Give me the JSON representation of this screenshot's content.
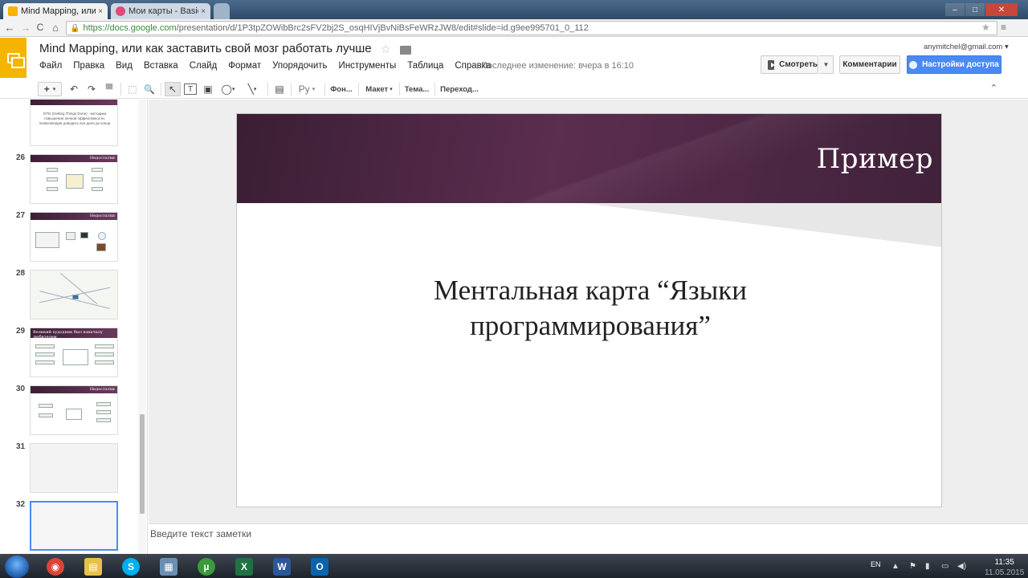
{
  "browser": {
    "tabs": [
      {
        "title": "Mind Mapping, или",
        "close": "×",
        "favicon_color": "#f4b400"
      },
      {
        "title": "Мои карты - Basic",
        "close": "×",
        "favicon_color": "#e04a7a"
      }
    ],
    "url_host": "https://docs.google.com",
    "url_path": "/presentation/d/1P3tpZOWibBrc2sFV2bj2S_osqHIVjBvNiBsFeWRzJW8/edit#slide=id.g9ee995701_0_112",
    "nav": {
      "back": "←",
      "forward": "→",
      "reload": "C",
      "home": "⌂"
    }
  },
  "docs": {
    "title": "Mind Mapping, или как заставить свой мозг работать лучше",
    "menu": [
      "Файл",
      "Правка",
      "Вид",
      "Вставка",
      "Слайд",
      "Формат",
      "Упорядочить",
      "Инструменты",
      "Таблица",
      "Справка"
    ],
    "last_edit": "Последнее изменение: вчера в 16:10",
    "account": "anymitchel@gmail.com",
    "present_label": "Смотреть",
    "comments_label": "Комментарии",
    "share_label": "Настройки доступа",
    "brand_color": "#f4b400",
    "share_color": "#4a8af4"
  },
  "toolbar": {
    "add": "+",
    "undo": "↶",
    "redo": "↷",
    "zoom": "🔍",
    "select": "↖",
    "text": "T",
    "font": "Ру",
    "background_label": "Фон...",
    "layout_label": "Макет",
    "theme_label": "Тема...",
    "transition_label": "Переход...",
    "collapse": "⌃"
  },
  "filmstrip": {
    "first_partial_text": "GTD (Getting Things Done) - методика повышения личной эффективности, позволяющая доводить все дела до конца",
    "slides": [
      {
        "number": "26",
        "band": "Недостатки"
      },
      {
        "number": "27",
        "band": "Недостатки"
      },
      {
        "number": "28",
        "band": ""
      },
      {
        "number": "29",
        "band": "Великий худодник был взначалу любителем"
      },
      {
        "number": "30",
        "band": "Недостатки"
      },
      {
        "number": "31",
        "band": ""
      },
      {
        "number": "32",
        "band": ""
      }
    ]
  },
  "slide": {
    "title": "Пример",
    "body_line1": "Ментальная карта “Языки",
    "body_line2": "программирования”",
    "header_color": "#4a2542"
  },
  "notes": {
    "placeholder": "Введите текст заметки"
  },
  "taskbar": {
    "language": "EN",
    "time": "11:35",
    "date": "11.05.2015",
    "apps": [
      {
        "name": "chrome",
        "glyph": "◉",
        "color": "#db4437"
      },
      {
        "name": "explorer",
        "glyph": "▤",
        "color": "#e8c04a"
      },
      {
        "name": "skype",
        "glyph": "S",
        "color": "#00aff0"
      },
      {
        "name": "notepad",
        "glyph": "▦",
        "color": "#6b8fb3"
      },
      {
        "name": "utorrent",
        "glyph": "µ",
        "color": "#3b9a3b"
      },
      {
        "name": "excel",
        "glyph": "X",
        "color": "#1f7244"
      },
      {
        "name": "word",
        "glyph": "W",
        "color": "#2b579a"
      },
      {
        "name": "outlook",
        "glyph": "O",
        "color": "#0a64ad"
      }
    ]
  }
}
